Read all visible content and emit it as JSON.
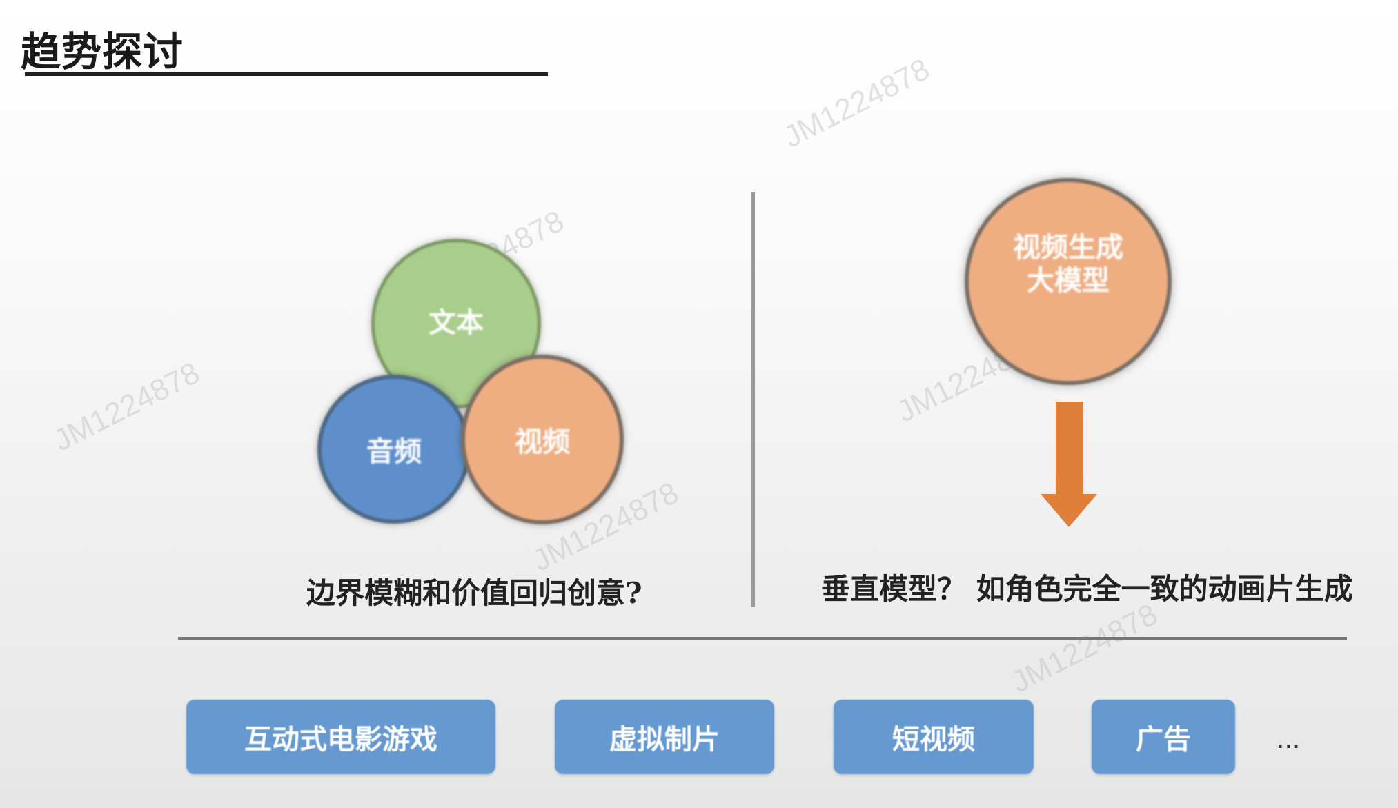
{
  "title": "趋势探讨",
  "watermark": "JM1224878",
  "left_panel": {
    "circles": {
      "text": "文本",
      "audio": "音频",
      "video": "视频"
    },
    "caption": "边界模糊和价值回归创意?"
  },
  "right_panel": {
    "circle_line1": "视频生成",
    "circle_line2": "大模型",
    "caption": "垂直模型？ 如角色完全一致的动画片生成"
  },
  "applications": [
    "互动式电影游戏",
    "虚拟制片",
    "短视频",
    "广告"
  ],
  "ellipsis": "...",
  "colors": {
    "green_circle": "#a9cd8c",
    "blue_circle": "#5f8fca",
    "orange_circle": "#eeae82",
    "arrow": "#e07f3a",
    "button": "#6699cf"
  }
}
